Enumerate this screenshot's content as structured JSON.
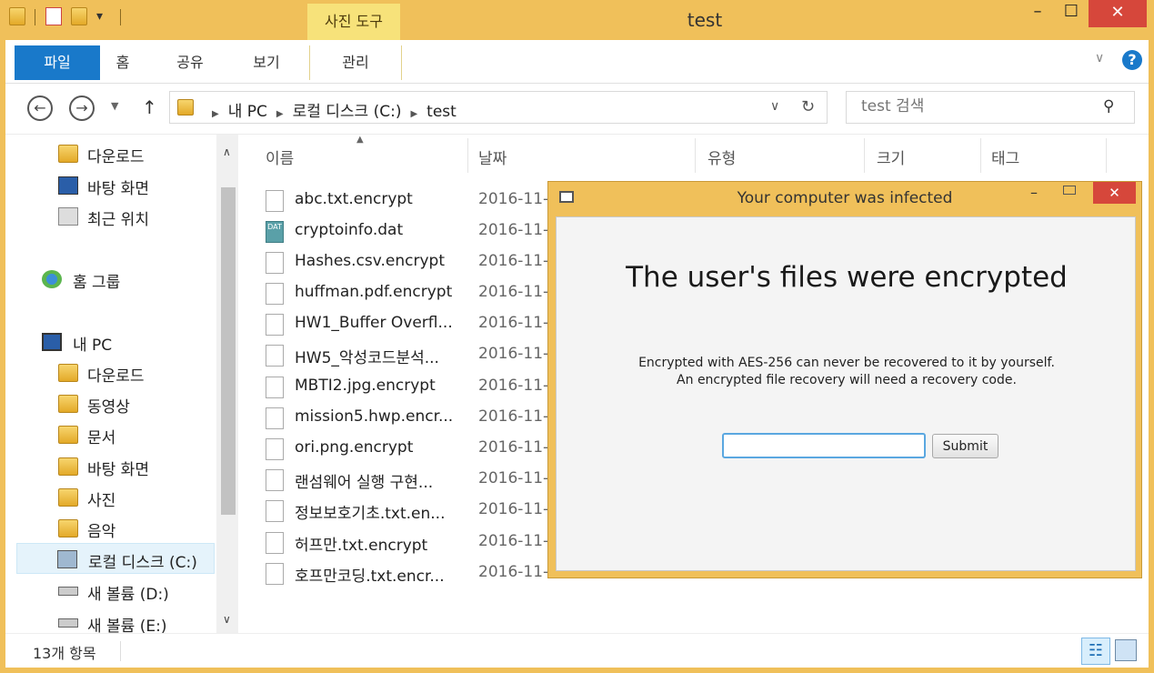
{
  "titlebar": {
    "title": "test",
    "contextual_tab": "사진 도구",
    "minimize": "–",
    "maximize": "☐",
    "close": "✕"
  },
  "ribbon": {
    "tabs": [
      "파일",
      "홈",
      "공유",
      "보기",
      "관리"
    ]
  },
  "address": {
    "crumbs": [
      "내 PC",
      "로컬 디스크 (C:)",
      "test"
    ],
    "search_placeholder": "test 검색"
  },
  "nav": {
    "items": [
      {
        "label": "다운로드",
        "icon": "downloads-icon"
      },
      {
        "label": "바탕 화면",
        "icon": "desktop-icon"
      },
      {
        "label": "최근 위치",
        "icon": "recent-places-icon"
      },
      {
        "label": "홈 그룹",
        "icon": "homegroup-icon"
      },
      {
        "label": "내 PC",
        "icon": "computer-icon"
      },
      {
        "label": "다운로드",
        "icon": "downloads-icon"
      },
      {
        "label": "동영상",
        "icon": "videos-icon"
      },
      {
        "label": "문서",
        "icon": "documents-icon"
      },
      {
        "label": "바탕 화면",
        "icon": "desktop-icon"
      },
      {
        "label": "사진",
        "icon": "pictures-icon"
      },
      {
        "label": "음악",
        "icon": "music-icon"
      },
      {
        "label": "로컬 디스크 (C:)",
        "icon": "drive-icon"
      },
      {
        "label": "새 볼륨 (D:)",
        "icon": "drive-icon"
      },
      {
        "label": "새 볼륨 (E:)",
        "icon": "drive-icon"
      }
    ]
  },
  "columns": [
    "이름",
    "날짜",
    "유형",
    "크기",
    "태그"
  ],
  "files": [
    {
      "name": "abc.txt.encrypt",
      "date": "2016-11-"
    },
    {
      "name": "cryptoinfo.dat",
      "date": "2016-11-"
    },
    {
      "name": "Hashes.csv.encrypt",
      "date": "2016-11-"
    },
    {
      "name": "huffman.pdf.encrypt",
      "date": "2016-11-"
    },
    {
      "name": "HW1_Buffer Overfl...",
      "date": "2016-11-"
    },
    {
      "name": "HW5_악성코드분석...",
      "date": "2016-11-"
    },
    {
      "name": "MBTI2.jpg.encrypt",
      "date": "2016-11-"
    },
    {
      "name": "mission5.hwp.encr...",
      "date": "2016-11-"
    },
    {
      "name": "ori.png.encrypt",
      "date": "2016-11-"
    },
    {
      "name": "랜섬웨어 실행 구현...",
      "date": "2016-11-"
    },
    {
      "name": "정보보호기초.txt.en...",
      "date": "2016-11-"
    },
    {
      "name": "허프만.txt.encrypt",
      "date": "2016-11-"
    },
    {
      "name": "호프만코딩.txt.encr...",
      "date": "2016-11-"
    }
  ],
  "status": {
    "item_count": "13개 항목"
  },
  "dialog": {
    "title": "Your computer was infected",
    "heading": "The user's files were encrypted",
    "message_line1": "Encrypted with AES-256 can never be recovered to it by yourself.",
    "message_line2": "An encrypted file recovery will need a recovery code.",
    "input_value": "",
    "submit_label": "Submit",
    "close": "✕"
  }
}
